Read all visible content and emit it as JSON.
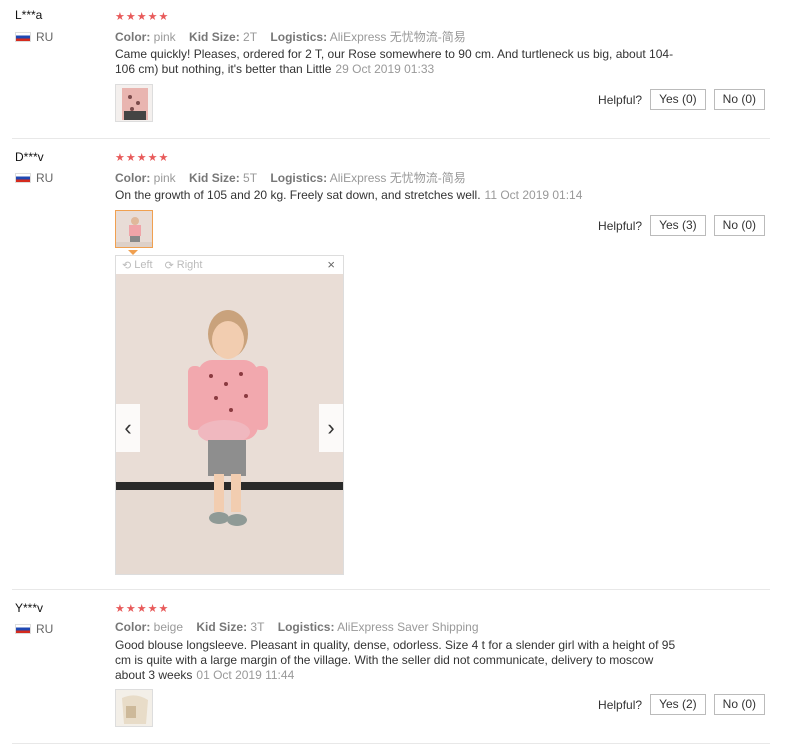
{
  "reviews": [
    {
      "user": "L***a",
      "country": "RU",
      "stars": "★★★★★",
      "color_label": "Color:",
      "color": "pink",
      "size_label": "Kid Size:",
      "size": "2T",
      "logistics_label": "Logistics:",
      "logistics": "AliExpress 无忧物流-简易",
      "text": "Came quickly! Pleases, ordered for 2 T, our Rose somewhere to 90 cm. And turtleneck us big, about 104-106 cm) but nothing, it's better than Little",
      "date": "29 Oct 2019 01:33",
      "helpful_label": "Helpful?",
      "yes": "Yes (0)",
      "no": "No (0)"
    },
    {
      "user": "D***v",
      "country": "RU",
      "stars": "★★★★★",
      "color_label": "Color:",
      "color": "pink",
      "size_label": "Kid Size:",
      "size": "5T",
      "logistics_label": "Logistics:",
      "logistics": "AliExpress 无忧物流-简易",
      "text": "On the growth of 105 and 20 kg. Freely sat down, and stretches well.",
      "date": "11 Oct 2019 01:14",
      "helpful_label": "Helpful?",
      "yes": "Yes (3)",
      "no": "No (0)"
    },
    {
      "user": "Y***v",
      "country": "RU",
      "stars": "★★★★★",
      "color_label": "Color:",
      "color": "beige",
      "size_label": "Kid Size:",
      "size": "3T",
      "logistics_label": "Logistics:",
      "logistics": "AliExpress Saver Shipping",
      "text": "Good blouse longsleeve. Pleasant in quality, dense, odorless. Size 4 t for a slender girl with a height of 95 cm is quite with a large margin of the village. With the seller did not communicate, delivery to moscow about 3 weeks",
      "date": "01 Oct 2019 11:44",
      "helpful_label": "Helpful?",
      "yes": "Yes (2)",
      "no": "No (0)"
    }
  ],
  "viewer": {
    "left_label": "Left",
    "right_label": "Right",
    "close": "×",
    "prev": "‹",
    "next": "›"
  }
}
